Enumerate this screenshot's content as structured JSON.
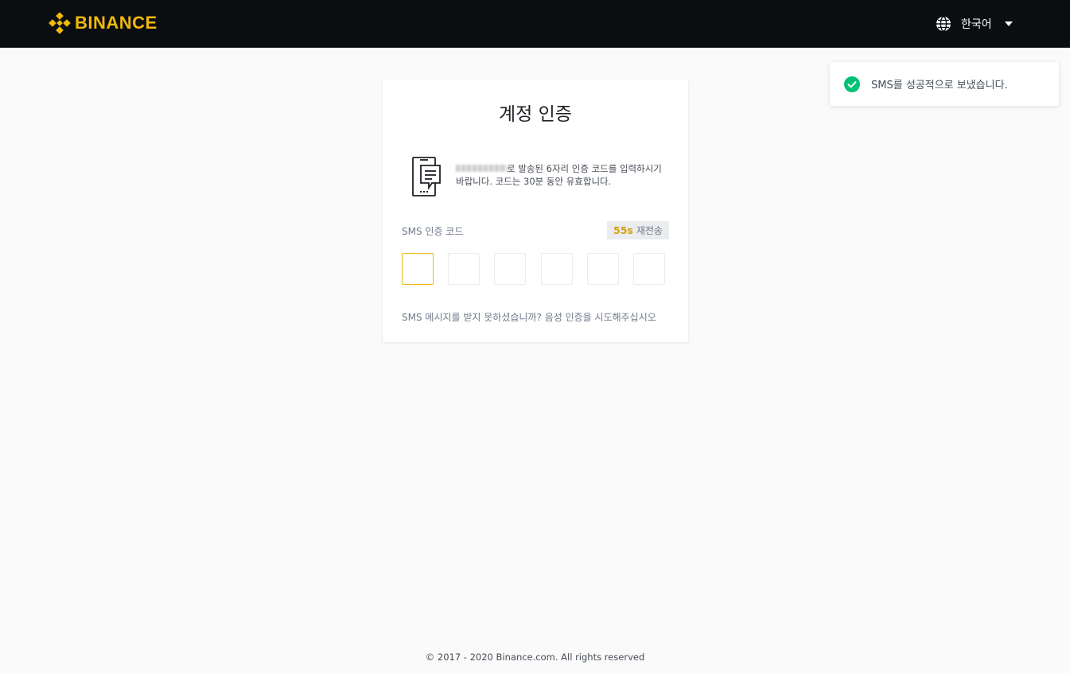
{
  "header": {
    "brand": "BINANCE",
    "language": "한국어",
    "icons": {
      "logo": "binance-diamond-logo",
      "language": "globe-icon",
      "dropdown": "caret-down-icon"
    },
    "brand_color": "#f0b90b"
  },
  "toast": {
    "message": "SMS를 성공적으로 보냈습니다.",
    "icon": "check-circle-icon",
    "status_color": "#02c076"
  },
  "card": {
    "title": "계정 인증",
    "icon": "phone-message-icon",
    "instruction": "로 발송된 6자리 인증 코드를 입력하시기 바랍니다. 코드는 30분 동안 유효합니다.",
    "code_label": "SMS 인증 코드",
    "resend": {
      "seconds": "55s",
      "label": "재전송"
    },
    "code_digits": [
      "",
      "",
      "",
      "",
      "",
      ""
    ],
    "alt_link": "SMS 메시지를 받지 못하셨습니까? 음성 인증을 시도해주십시오"
  },
  "footer": {
    "copyright": "© 2017 - 2020 Binance.com. All rights reserved"
  }
}
